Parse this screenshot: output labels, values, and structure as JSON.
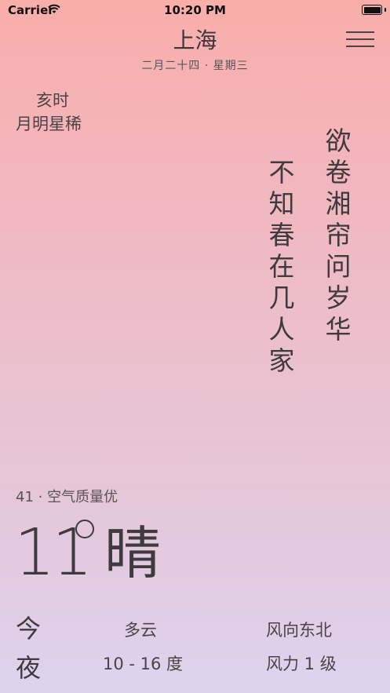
{
  "status_bar": {
    "carrier": "Carrier",
    "time": "10:20 PM"
  },
  "header": {
    "city": "上海",
    "date": "二月二十四 · 星期三",
    "menu_icon": "hamburger-menu-icon"
  },
  "time_of_day": {
    "hour": "亥时",
    "phrase": "月明星稀"
  },
  "poem": {
    "line1": "欲卷湘帘问岁华",
    "line2": "不知春在几人家"
  },
  "air_quality": "41 · 空气质量优",
  "current": {
    "temperature": "11",
    "condition": "晴"
  },
  "tonight": {
    "label_top": "今",
    "label_bottom": "夜",
    "condition": "多云",
    "range": "10 - 16 度",
    "wind_direction": "风向东北",
    "wind_level": "风力 1 级"
  },
  "colors": {
    "gradient_top": "#f9aeaa",
    "gradient_bottom": "#ddd3ee",
    "text": "#3f3a3d"
  }
}
